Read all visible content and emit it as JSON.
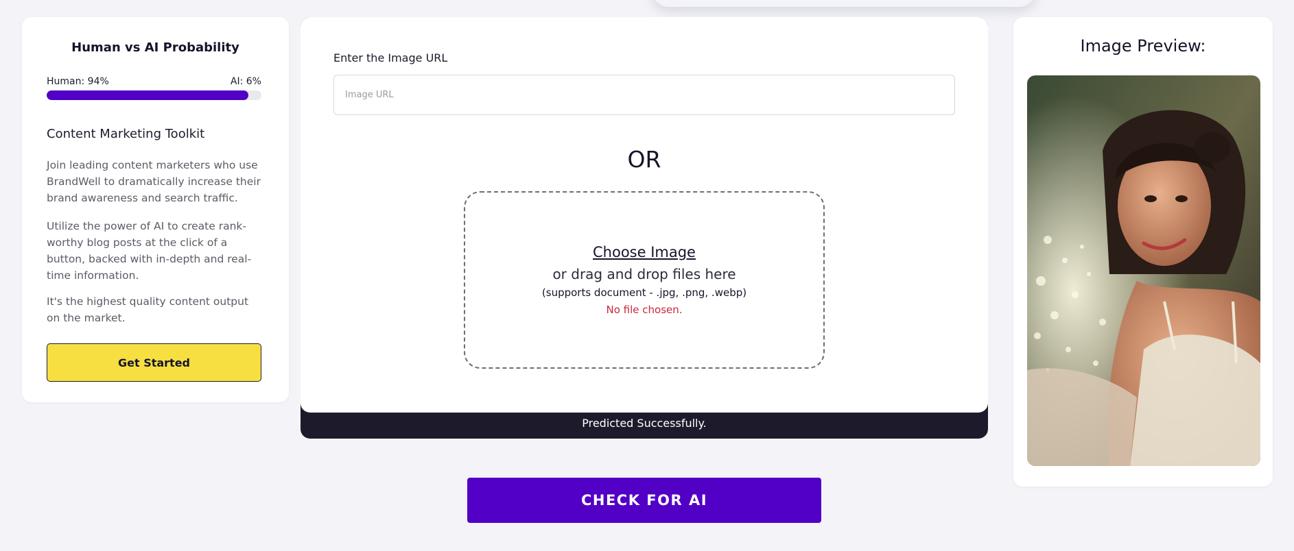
{
  "probability": {
    "title": "Human vs AI Probability",
    "human_label": "Human: 94%",
    "ai_label": "AI: 6%",
    "human_fraction": 0.94
  },
  "toolkit": {
    "title": "Content Marketing Toolkit",
    "paragraphs": [
      "Join leading content marketers who use BrandWell to dramatically increase their brand awareness and search traffic.",
      "Utilize the power of AI to create rank-worthy blog posts at the click of a button, backed with in-depth and real-time information.",
      "It's the highest quality content output on the market."
    ],
    "cta_label": "Get Started"
  },
  "upload": {
    "url_label": "Enter the Image URL",
    "url_placeholder": "Image URL",
    "url_value": "",
    "or_text": "OR",
    "choose_label": "Choose Image",
    "drag_text": "or drag and drop files here",
    "supports_text": "(supports document - .jpg, .png, .webp)",
    "file_status": "No file chosen."
  },
  "status": {
    "message": "Predicted Successfully."
  },
  "actions": {
    "check_label": "CHECK FOR AI"
  },
  "preview": {
    "title": "Image Preview:"
  },
  "colors": {
    "accent": "#5200c6",
    "cta_yellow": "#f7df41",
    "error": "#c8283c",
    "status_bar": "#1d1b2b"
  }
}
